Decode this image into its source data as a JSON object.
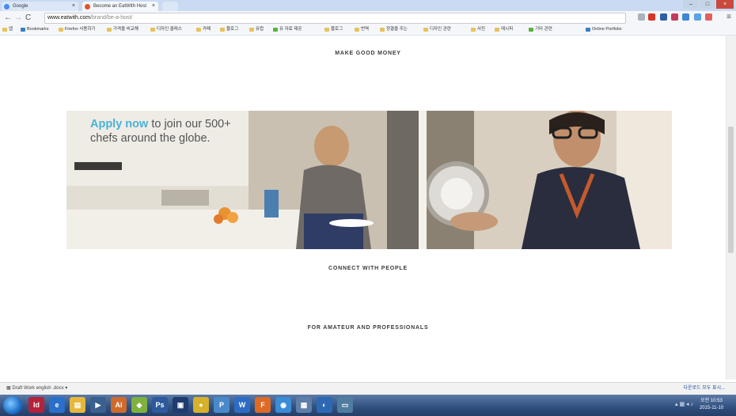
{
  "browser": {
    "tabs": [
      {
        "label": "Google",
        "active": false
      },
      {
        "label": "Become an EatWith Host",
        "active": true
      },
      {
        "label": "",
        "active": false
      }
    ],
    "url_host": "www.eatwith.com",
    "url_path": "/brand/be-a-host/",
    "bookmarks": [
      "Bookmarks",
      "Firefox 사용하기",
      "가격을 비교해",
      "디자인 클래스",
      "카페",
      "블로그",
      "유럽",
      "유 자료 제공",
      "블로그",
      "번역",
      "정결을 주는",
      "디자인 관련",
      "사진",
      "레시피",
      "기타 관련",
      "Online Portfolio"
    ]
  },
  "page": {
    "section1": {
      "title": "MAKE GOOD MONEY"
    },
    "hero": {
      "apply_link": "Apply now",
      "apply_text": " to join our 500+ chefs around the globe."
    },
    "section2": {
      "title": "CONNECT WITH PEOPLE"
    },
    "section3": {
      "title": "FOR AMATEUR AND PROFESSIONALS"
    }
  },
  "statusbar": {
    "download_name": "Draft Work english .docx",
    "show_all": "다운로드 모두 표시..."
  },
  "taskbar": {
    "clock_time": "오전 10:53",
    "clock_date": "2015-11-10"
  },
  "colors": {
    "accent": "#49b2d6",
    "text": "#555555"
  }
}
